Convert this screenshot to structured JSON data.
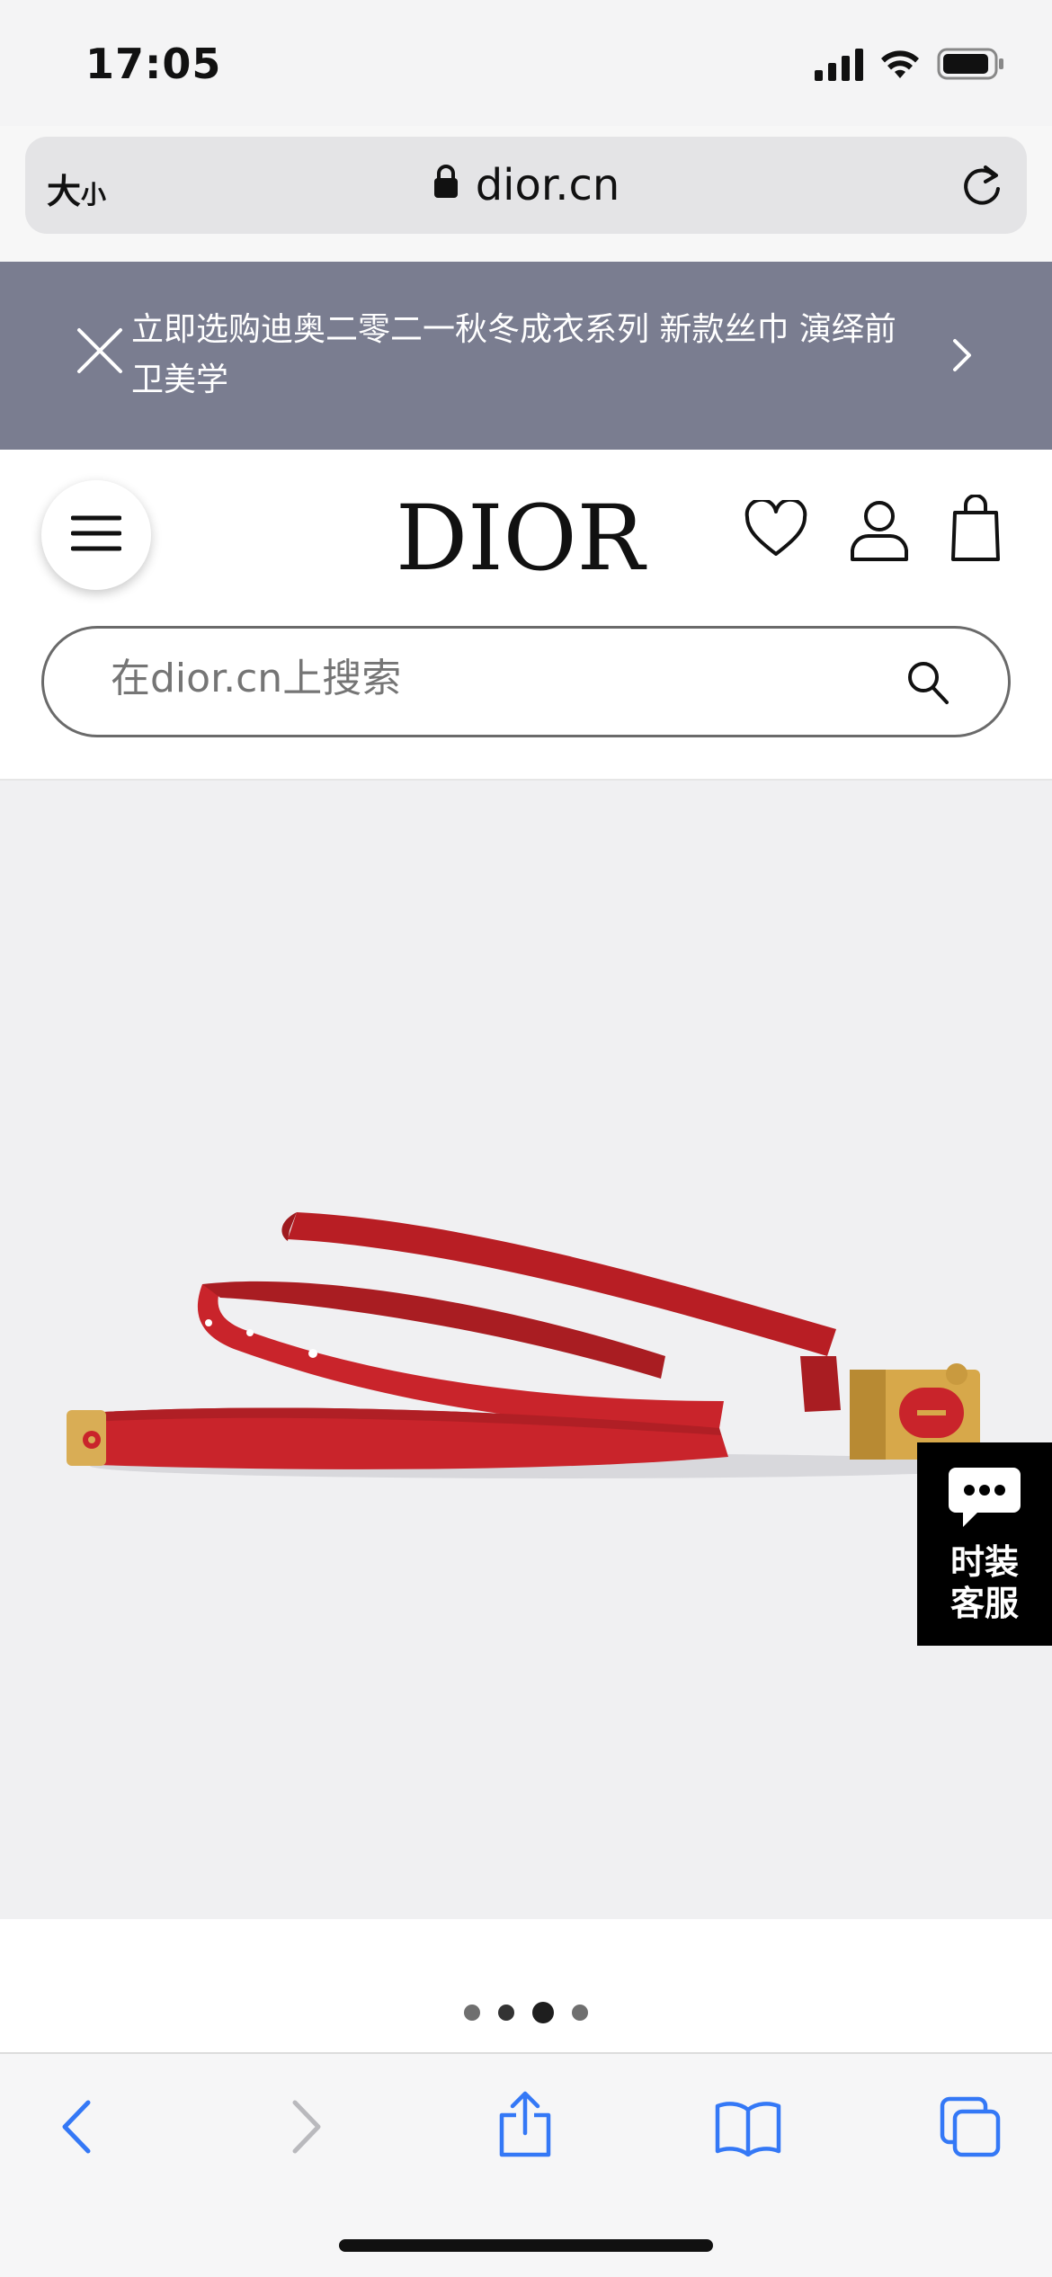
{
  "status_bar": {
    "time": "17:05"
  },
  "url_bar": {
    "text_size_label": "大",
    "text_size_small": "小",
    "domain": "dior.cn"
  },
  "promo": {
    "text": "立即选购迪奥二零二一秋冬成衣系列 新款丝巾 演绎前卫美学"
  },
  "header": {
    "logo": "DIOR",
    "search_placeholder": "在dior.cn上搜索"
  },
  "chat_widget": {
    "line1": "时装",
    "line2": "客服"
  },
  "carousel": {
    "total": 4,
    "active_index": 2
  },
  "colors": {
    "promo_bg": "#7a7d90",
    "belt_red": "#c9242b",
    "gold": "#d7a84a",
    "ios_blue": "#3478f6"
  }
}
